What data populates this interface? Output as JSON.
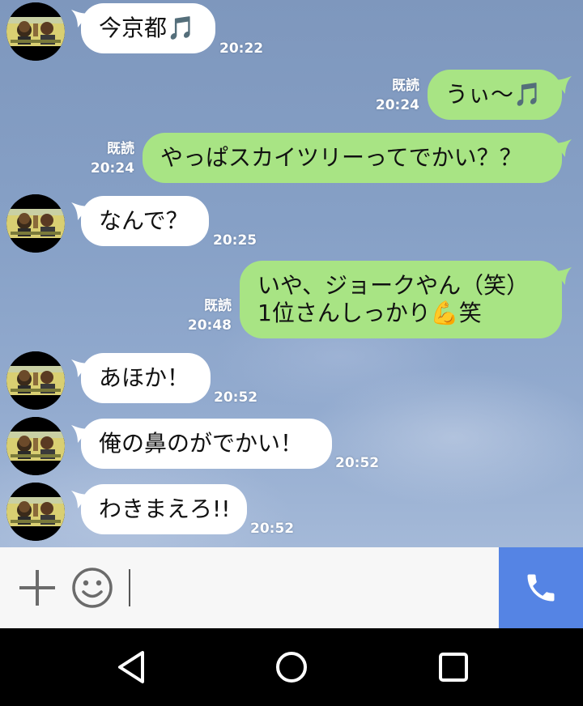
{
  "messages": [
    {
      "id": "m1",
      "side": "left",
      "text": "今京都",
      "emoji": "🎵",
      "time": "20:22"
    },
    {
      "id": "m2",
      "side": "right",
      "read": "既読",
      "text": "うぃ〜",
      "emoji": "🎵",
      "time": "20:24"
    },
    {
      "id": "m3",
      "side": "right",
      "read": "既読",
      "text": "やっぱスカイツリーってでかい？？",
      "time": "20:24"
    },
    {
      "id": "m4",
      "side": "left",
      "text": "なんで？",
      "time": "20:25"
    },
    {
      "id": "m5",
      "side": "right",
      "read": "既読",
      "line1": "いや、ジョークやん（笑）",
      "line2_pre": "1位さんしっかり",
      "emoji": "💪",
      "line2_post": "笑",
      "time": "20:48"
    },
    {
      "id": "m6",
      "side": "left",
      "text": "あほか！",
      "time": "20:52"
    },
    {
      "id": "m7",
      "side": "left",
      "text": "俺の鼻のがでかい！",
      "time": "20:52"
    },
    {
      "id": "m8",
      "side": "left",
      "text": "わきまえろ!!",
      "time": "20:52"
    }
  ],
  "colors": {
    "received_bubble": "#ffffff",
    "sent_bubble": "#a8e484",
    "call_button": "#5584e4",
    "input_bar": "#f7f7f7",
    "nav_bar": "#000000"
  },
  "icons": {
    "add": "plus-icon",
    "emoji": "smiley-icon",
    "call": "phone-icon",
    "back": "back-triangle-icon",
    "home": "home-circle-icon",
    "recents": "recents-square-icon"
  }
}
